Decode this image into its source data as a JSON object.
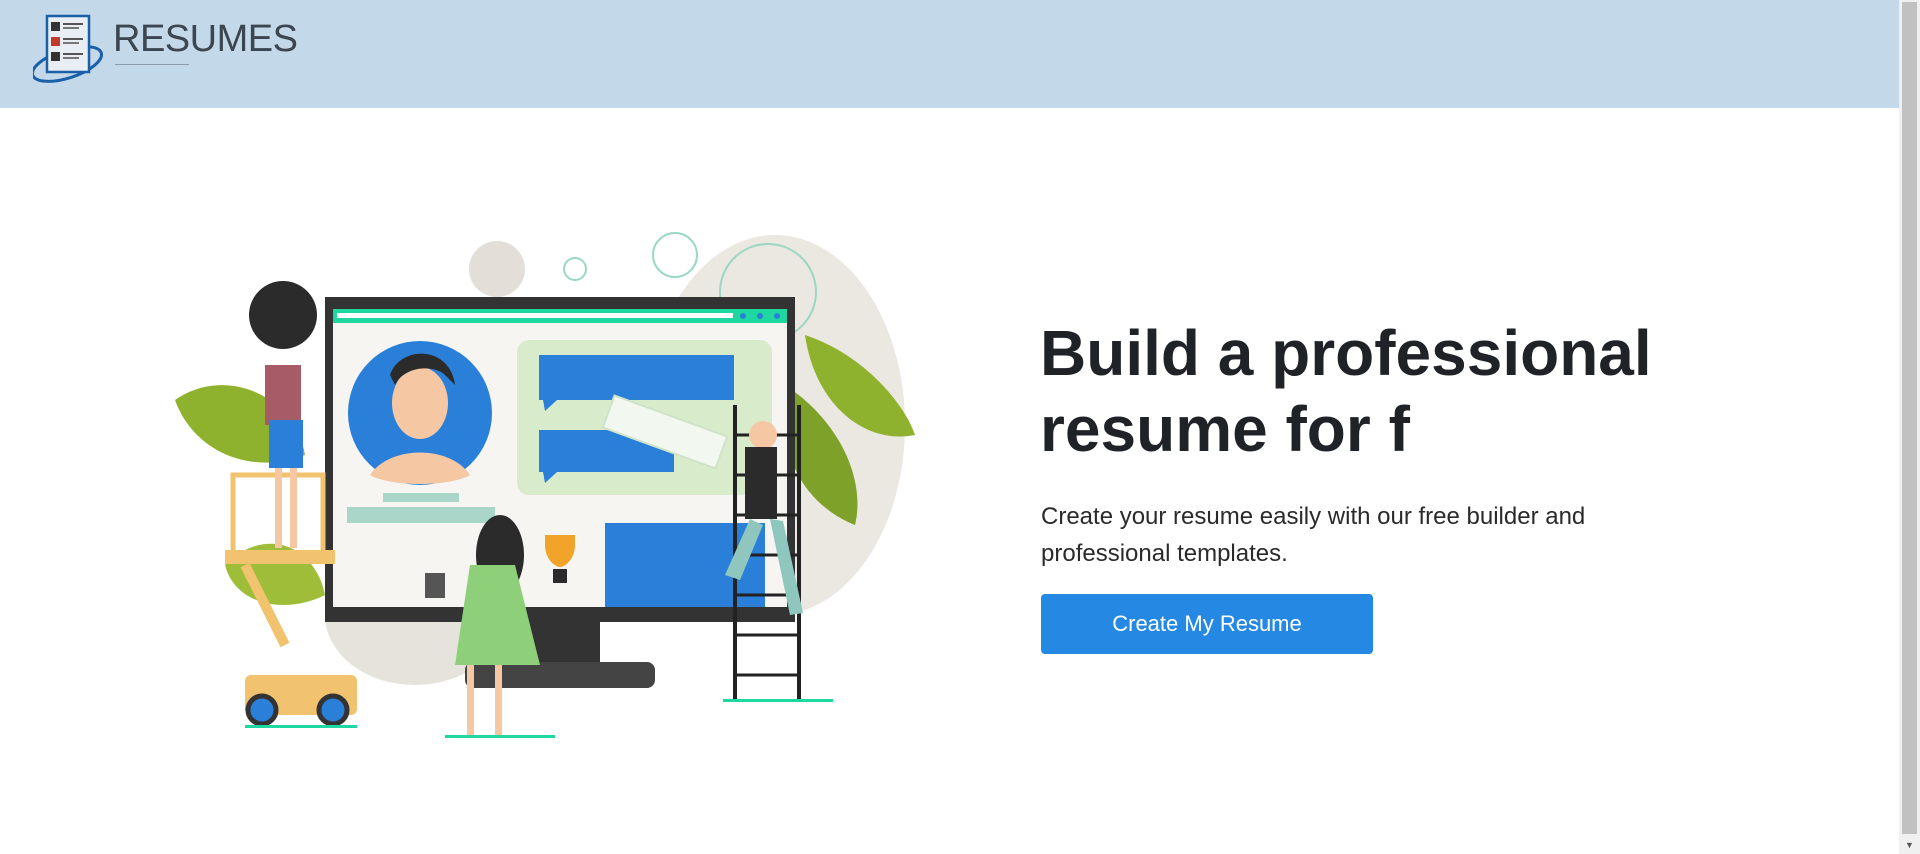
{
  "brand": {
    "name": "RESUMES"
  },
  "hero": {
    "title": "Build a professional resume for f",
    "subtitle": "Create your resume easily with our free builder and professional templates.",
    "cta_label": "Create My Resume"
  },
  "colors": {
    "header_bg": "#c3d9e9",
    "cta_bg": "#2589e3",
    "accent_green": "#1fd7a0",
    "illustration_blue": "#2a7fd9"
  },
  "icons": {
    "logo": "resume-document-icon",
    "scroll_down": "chevron-down-icon"
  }
}
